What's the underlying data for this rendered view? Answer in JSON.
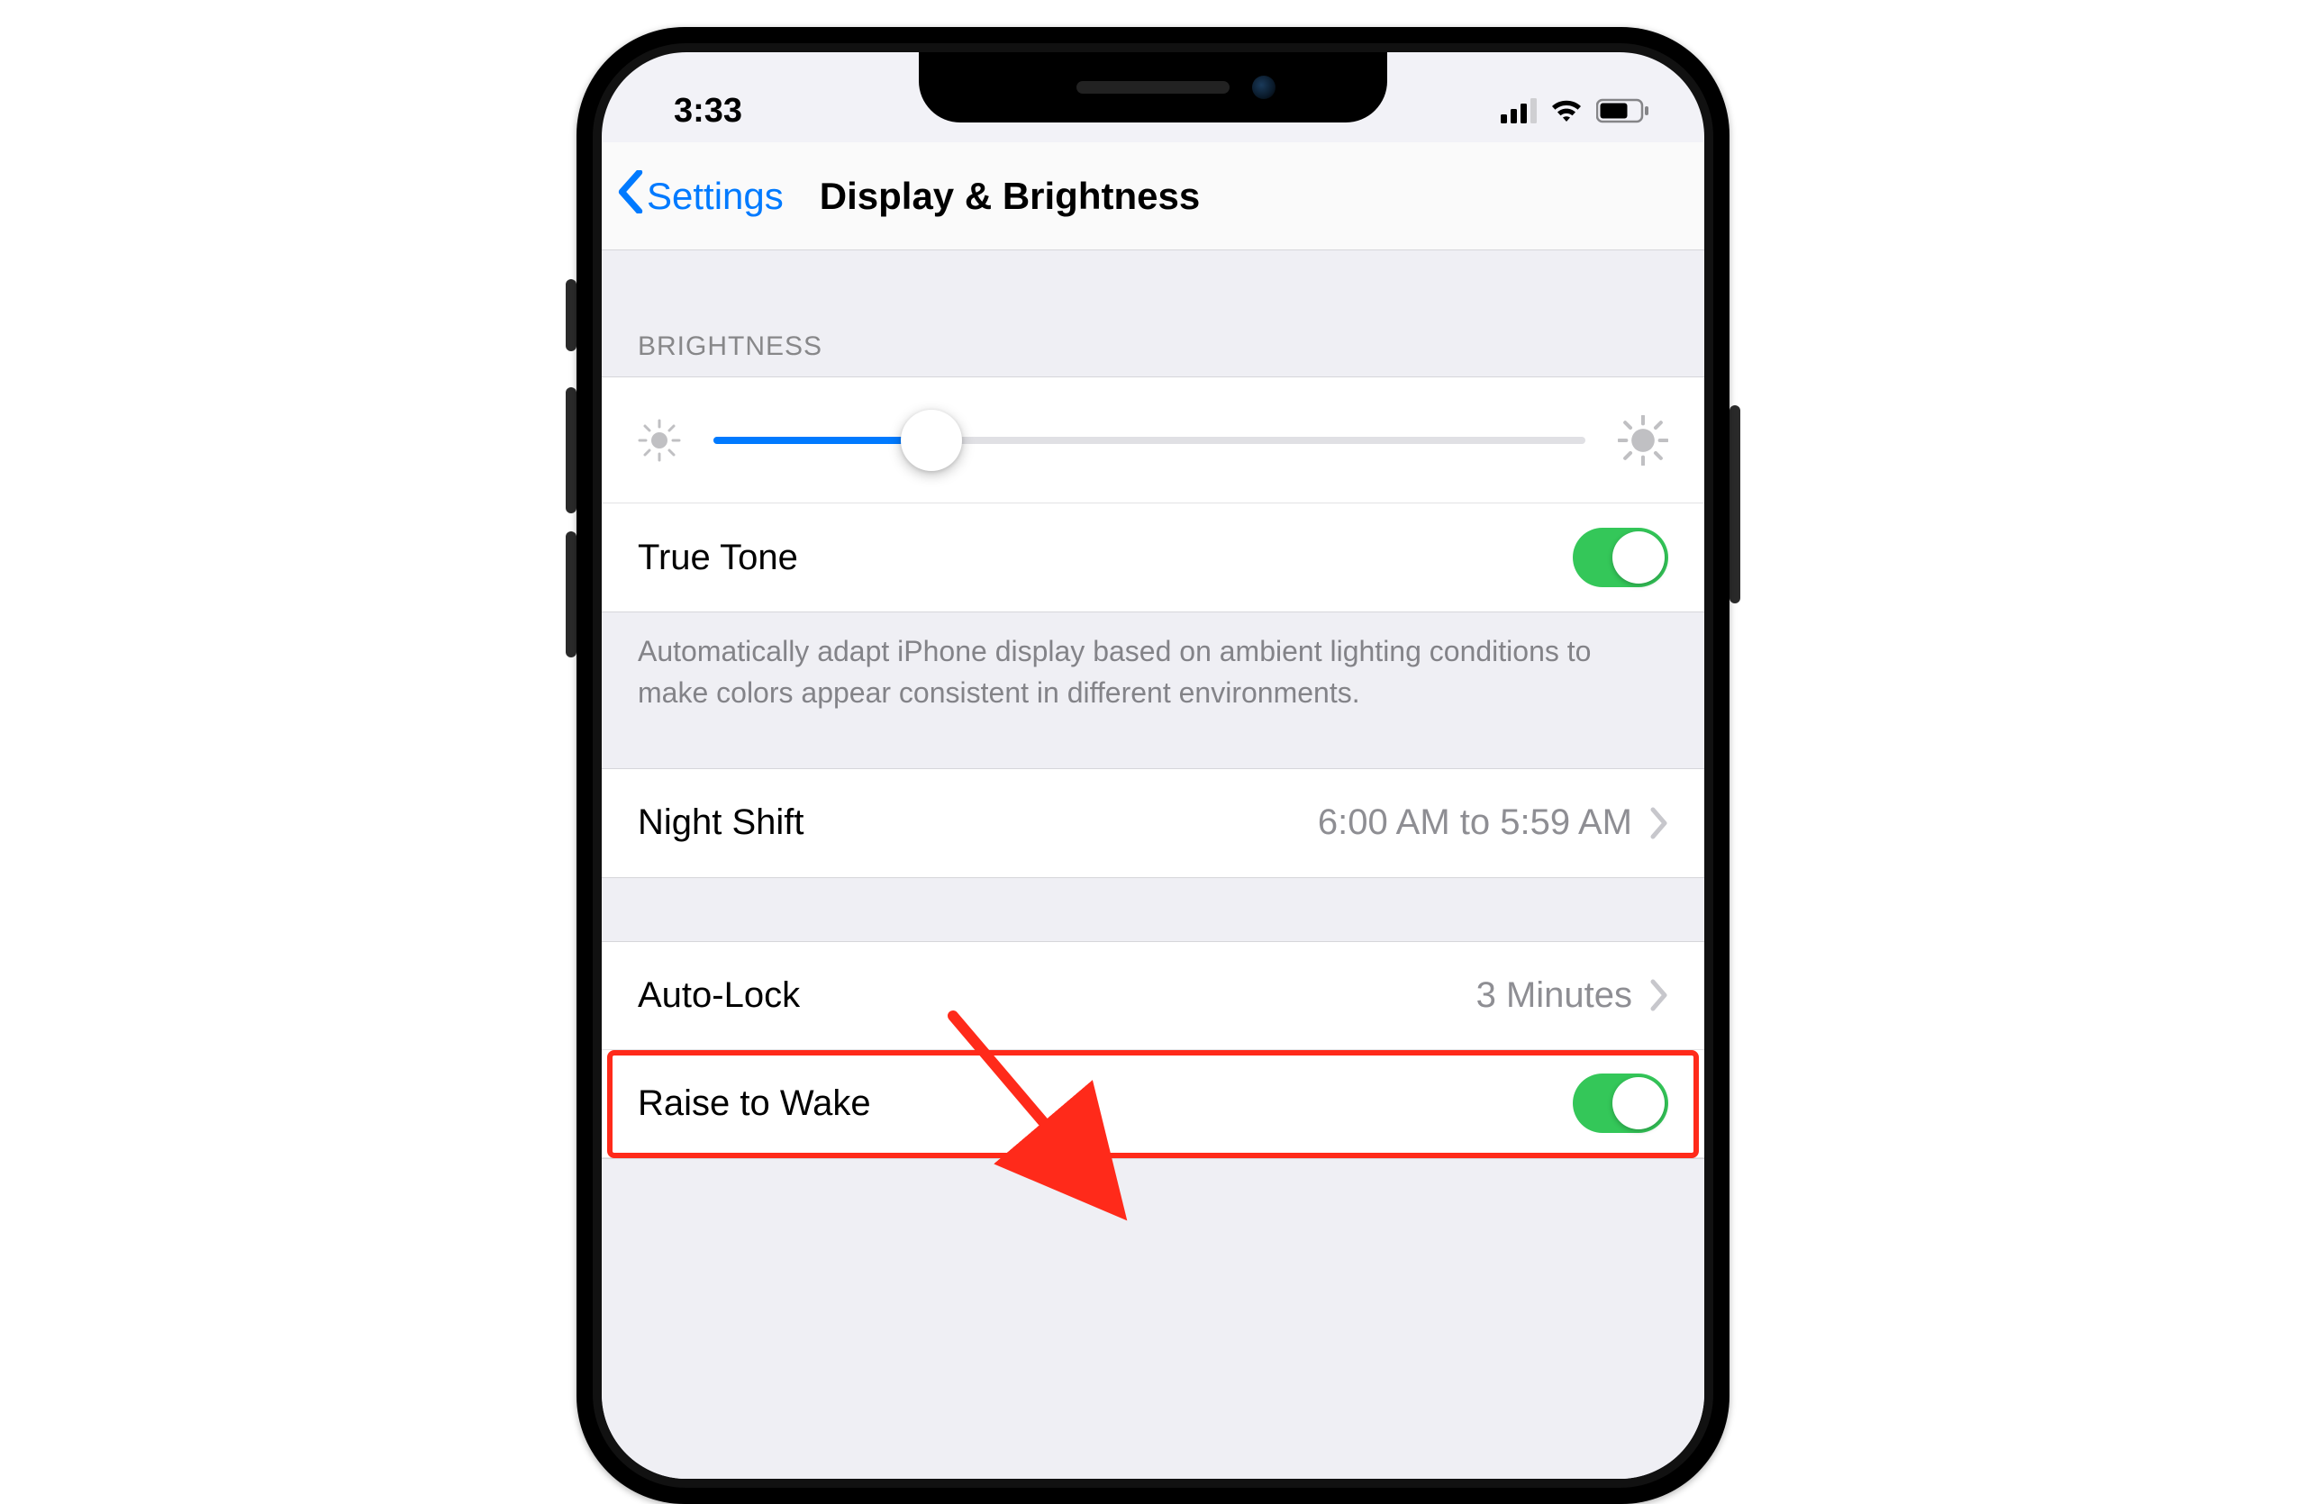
{
  "status": {
    "time": "3:33"
  },
  "nav": {
    "back_label": "Settings",
    "title": "Display & Brightness"
  },
  "brightness": {
    "section_title": "BRIGHTNESS",
    "slider_percent": 25,
    "true_tone_label": "True Tone",
    "true_tone_on": true,
    "footer": "Automatically adapt iPhone display based on ambient lighting conditions to make colors appear consistent in different environments."
  },
  "night_shift": {
    "label": "Night Shift",
    "value": "6:00 AM to 5:59 AM"
  },
  "auto_lock": {
    "label": "Auto-Lock",
    "value": "3 Minutes"
  },
  "raise_to_wake": {
    "label": "Raise to Wake",
    "on": true
  },
  "colors": {
    "ios_blue": "#007aff",
    "ios_green": "#34c759",
    "highlight_red": "#ff2a1a"
  }
}
